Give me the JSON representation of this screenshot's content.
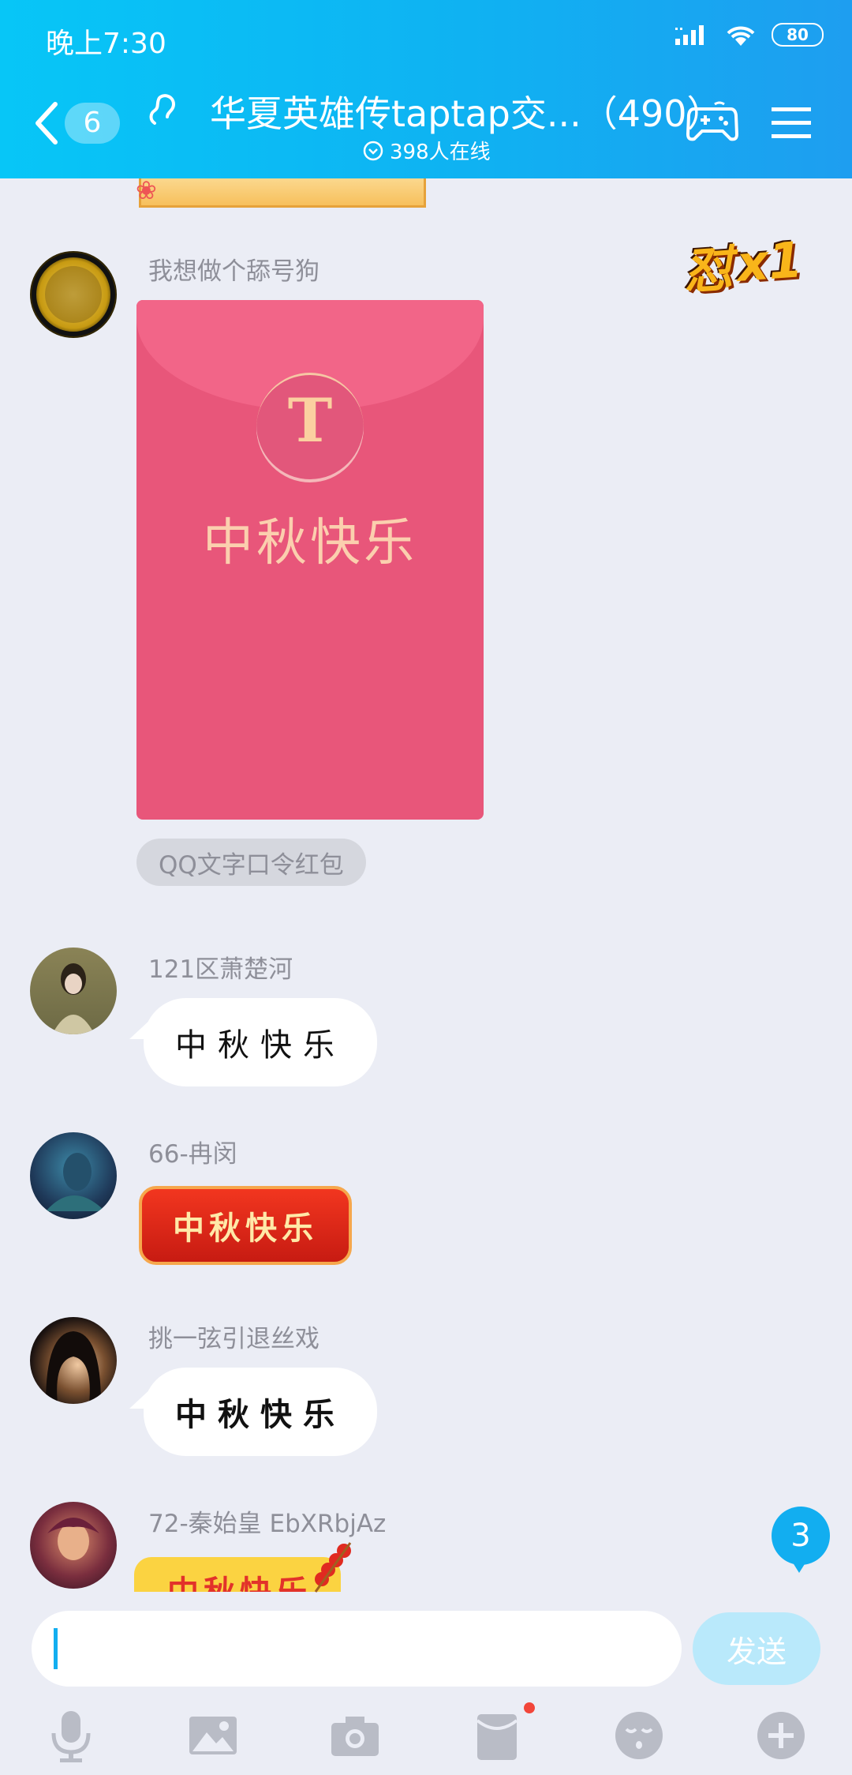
{
  "status_bar": {
    "time": "晚上7:30",
    "battery": "80"
  },
  "header": {
    "unread_count": "6",
    "title": "华夏英雄传taptap交...（490）",
    "online": "398人在线"
  },
  "reaction": {
    "text": "怼",
    "count": "x1"
  },
  "messages": [
    {
      "sender": "我想做个舔号狗",
      "type": "red_packet",
      "packet_icon": "T",
      "packet_text": "中秋快乐",
      "packet_label": "QQ文字口令红包"
    },
    {
      "sender": "121区萧楚河",
      "type": "text",
      "text": "中秋快乐"
    },
    {
      "sender": "66-冉闵",
      "type": "sticker_bubble",
      "text": "中秋快乐"
    },
    {
      "sender": "挑一弦引退丝戏",
      "type": "text",
      "text": "中秋快乐"
    },
    {
      "sender": "72-秦始皇 EbXRbjAz",
      "type": "sticker_bubble",
      "text": "中秋快乐"
    }
  ],
  "new_messages_badge": "3",
  "input": {
    "value": "",
    "send_label": "发送"
  },
  "toolbar": [
    "microphone-icon",
    "image-icon",
    "camera-icon",
    "red-packet-icon",
    "emoji-icon",
    "plus-icon"
  ],
  "colors": {
    "header": "#0fb2f2",
    "accent": "#12aef0",
    "red_packet": "#e8567a",
    "background": "#ebedf5"
  }
}
